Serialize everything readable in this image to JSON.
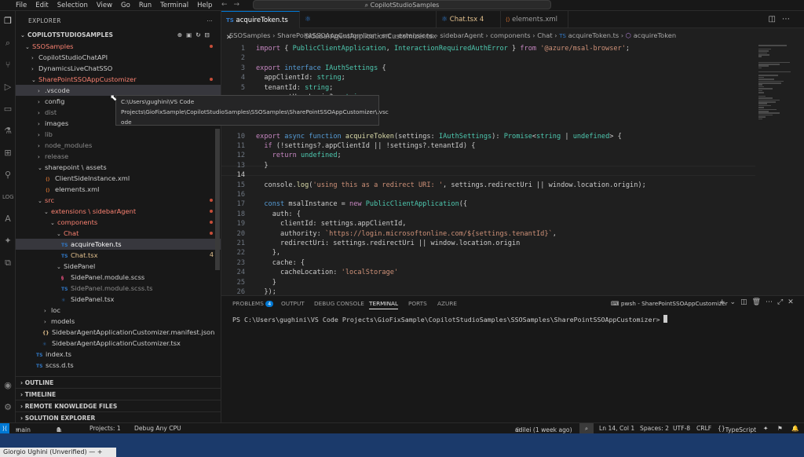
{
  "menu": [
    "File",
    "Edit",
    "Selection",
    "View",
    "Go",
    "Run",
    "Terminal",
    "Help"
  ],
  "search": {
    "text": "CopilotStudioSamples"
  },
  "explorer": {
    "title": "EXPLORER",
    "root": "COPILOTSTUDIOSAMPLES",
    "items": [
      {
        "label": "SSOSamples"
      },
      {
        "label": "CopilotStudioChatAPI"
      },
      {
        "label": "DynamicsLiveChatSSO"
      },
      {
        "label": "SharePointSSOAppCustomizer"
      },
      {
        "label": ".vscode"
      },
      {
        "label": "config"
      },
      {
        "label": "dist"
      },
      {
        "label": "images"
      },
      {
        "label": "lib"
      },
      {
        "label": "node_modules"
      },
      {
        "label": "release"
      },
      {
        "label": "sharepoint \\ assets"
      },
      {
        "label": "ClientSideInstance.xml"
      },
      {
        "label": "elements.xml"
      },
      {
        "label": "src"
      },
      {
        "label": "extensions \\ sidebarAgent"
      },
      {
        "label": "components"
      },
      {
        "label": "Chat"
      },
      {
        "label": "acquireToken.ts"
      },
      {
        "label": "Chat.tsx",
        "count": "4"
      },
      {
        "label": "SidePanel"
      },
      {
        "label": "SidePanel.module.scss"
      },
      {
        "label": "SidePanel.module.scss.ts"
      },
      {
        "label": "SidePanel.tsx"
      },
      {
        "label": "loc"
      },
      {
        "label": "models"
      },
      {
        "label": "SidebarAgentApplicationCustomizer.manifest.json"
      },
      {
        "label": "SidebarAgentApplicationCustomizer.tsx"
      },
      {
        "label": "index.ts"
      },
      {
        "label": "scss.d.ts"
      }
    ],
    "sections": [
      "OUTLINE",
      "TIMELINE",
      "REMOTE KNOWLEDGE FILES",
      "SOLUTION EXPLORER"
    ]
  },
  "tooltip": {
    "line1": "C:\\Users\\gughini\\VS Code",
    "line2": "Projects\\GioFixSample\\CopilotStudioSamples\\SSOSamples\\SharePointSSOAppCustomizer\\.vsc",
    "line3": "ode"
  },
  "tabs": [
    {
      "icon": "TS",
      "label": "acquireToken.ts"
    },
    {
      "icon": "TSX",
      "label": "SidebarAgentApplicationCustomizer.tsx"
    },
    {
      "icon": "TSX",
      "label": "Chat.tsx",
      "count": "4"
    },
    {
      "icon": "XML",
      "label": "elements.xml"
    }
  ],
  "breadcrumb": [
    "SSOSamples",
    "SharePointSSOAppCustomizer",
    "src",
    "extensions",
    "sidebarAgent",
    "components",
    "Chat",
    "acquireToken.ts",
    "acquireToken"
  ],
  "code": {
    "line_numbers": [
      "1",
      "2",
      "3",
      "4",
      "5",
      "",
      "",
      "",
      "",
      "10",
      "11",
      "12",
      "13",
      "14",
      "15",
      "16",
      "17",
      "18",
      "19",
      "20",
      "21",
      "22",
      "23",
      "24",
      "25",
      "26"
    ],
    "lines": [
      "import { PublicClientApplication, InteractionRequiredAuthError } from '@azure/msal-browser';",
      "",
      "export interface IAuthSettings {",
      "  appClientId: string;",
      "  tenantId: string;",
      "  currentUserLogin?: string;",
      "",
      "",
      "",
      "export async function acquireToken(settings: IAuthSettings): Promise<string | undefined> {",
      "  if (!settings?.appClientId || !settings?.tenantId) {",
      "    return undefined;",
      "  }",
      "",
      "  console.log('using this as a redirect URI: ', settings.redirectUri || window.location.origin);",
      "",
      "  const msalInstance = new PublicClientApplication({",
      "    auth: {",
      "      clientId: settings.appClientId,",
      "      authority: `https://login.microsoftonline.com/${settings.tenantId}`,",
      "      redirectUri: settings.redirectUri || window.location.origin",
      "    },",
      "    cache: {",
      "      cacheLocation: 'localStorage'",
      "    }",
      "  });"
    ]
  },
  "panel": {
    "tabs": [
      "PROBLEMS",
      "OUTPUT",
      "DEBUG CONSOLE",
      "TERMINAL",
      "PORTS",
      "AZURE"
    ],
    "problems_count": "4",
    "terminal_name": "pwsh - SharePointSSOAppCustomizer",
    "prompt": "PS C:\\Users\\gughini\\VS Code Projects\\GioFixSample\\CopilotStudioSamples\\SSOSamples\\SharePointSSOAppCustomizer>"
  },
  "status": {
    "branch": "main",
    "errors": "4",
    "warnings": "0",
    "projects": "Projects: 1",
    "debug": "Debug Any CPU",
    "blame": "adilei (1 week ago)",
    "position": "Ln 14, Col 1",
    "spaces": "Spaces: 2",
    "encoding": "UTF-8",
    "eol": "CRLF",
    "language": "TypeScript"
  },
  "taskbar": {
    "user": "Giorgio Ughini (Unverified)"
  },
  "colors": {
    "accent": "#0078d4",
    "modified": "#e2c08d",
    "error_dot": "#c74e39",
    "taskbar": "#1b3a6b"
  }
}
